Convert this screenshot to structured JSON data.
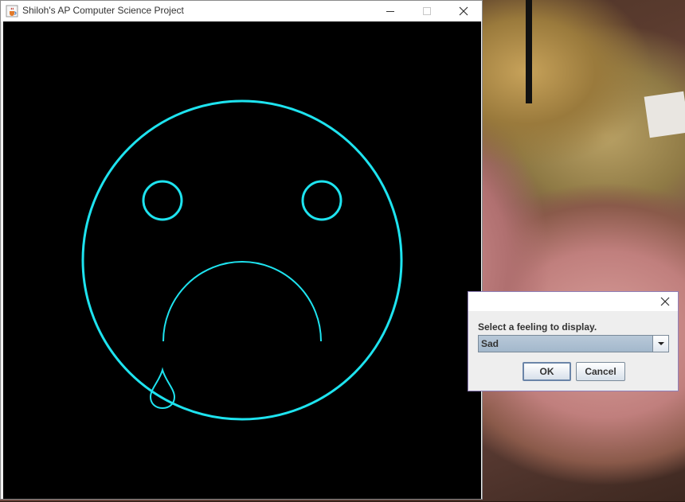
{
  "main_window": {
    "title": "Shiloh's AP Computer Science Project"
  },
  "canvas": {
    "background": "#000000",
    "stroke_color": "#1ee3ef",
    "face_expression": "sad"
  },
  "dialog": {
    "message": "Select a feeling to display.",
    "selected_feeling": "Sad",
    "ok_label": "OK",
    "cancel_label": "Cancel"
  },
  "icons": {
    "app": "java-cup-icon",
    "minimize": "minimize-icon",
    "maximize": "maximize-icon",
    "close": "close-icon",
    "dropdown": "chevron-down-icon"
  }
}
